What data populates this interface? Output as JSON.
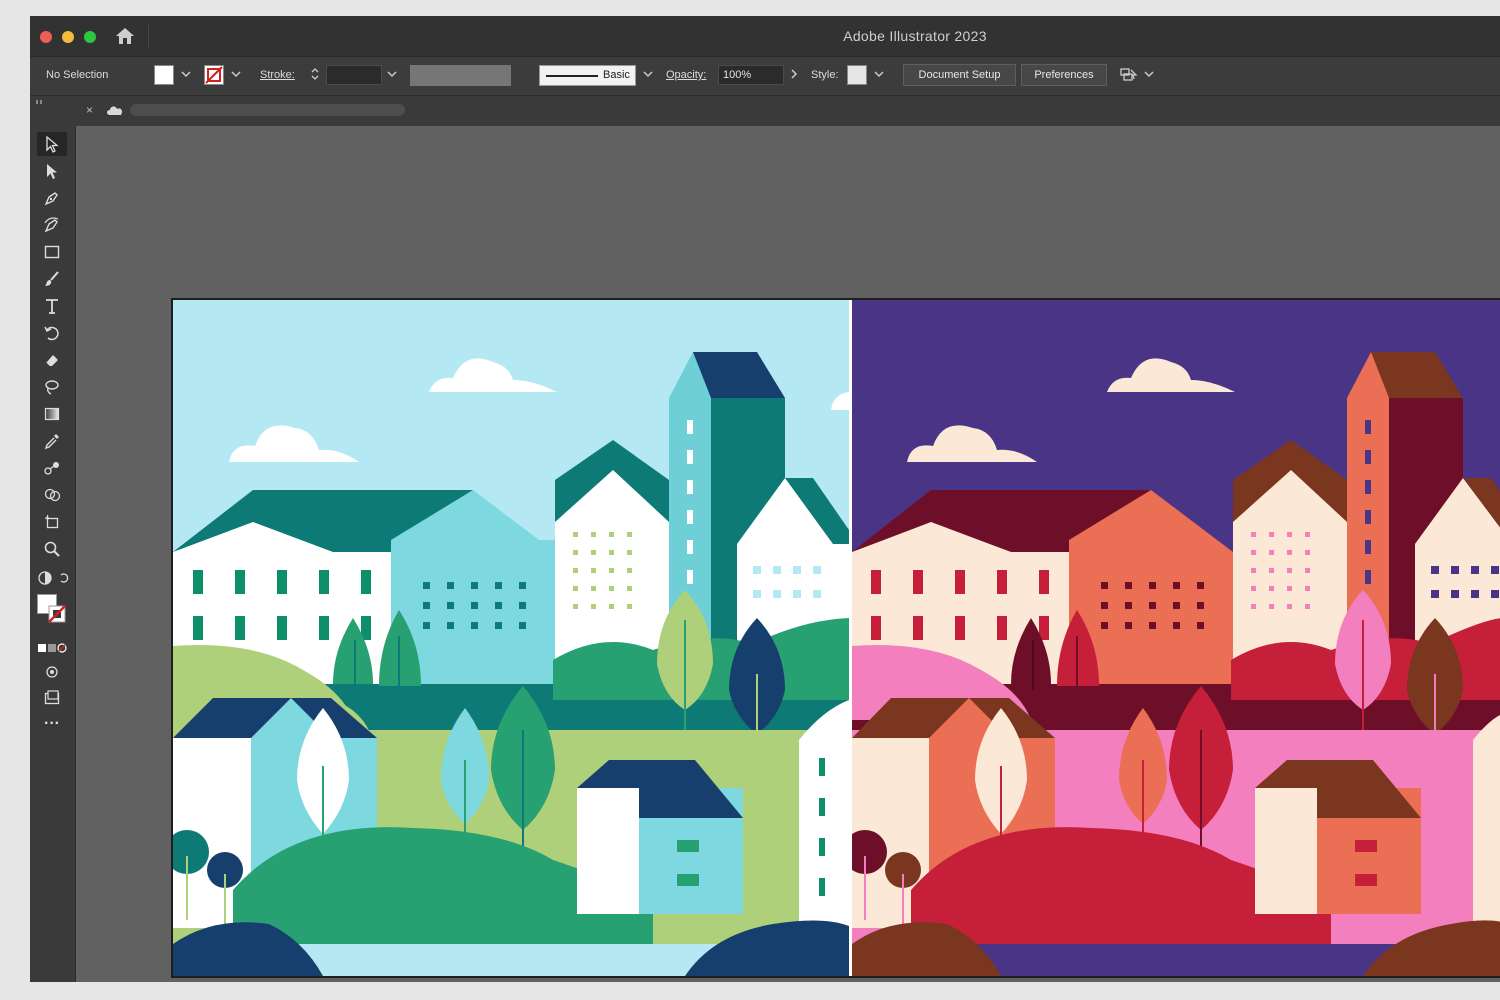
{
  "window": {
    "title": "Adobe Illustrator 2023",
    "buttons": [
      "close-button",
      "minimize-button",
      "zoom-button"
    ],
    "home_icon": "home-icon"
  },
  "control_bar": {
    "selection_status": "No Selection",
    "fill_color": "#ffffff",
    "stroke_label": "Stroke:",
    "stroke_value": "",
    "brush_label": "Basic",
    "opacity_label": "Opacity:",
    "opacity_value": "100%",
    "style_label": "Style:",
    "document_setup_label": "Document Setup",
    "preferences_label": "Preferences",
    "arrange_icon": "arrange-documents-icon"
  },
  "document_tab": {
    "close_label": "×",
    "cloud_icon": "cloud-document-icon"
  },
  "tools": [
    "selection-tool-icon",
    "direct-selection-tool-icon",
    "pen-tool-icon",
    "curvature-tool-icon",
    "rectangle-tool-icon",
    "paintbrush-tool-icon",
    "type-tool-icon",
    "rotate-tool-icon",
    "eraser-tool-icon",
    "lasso-tool-icon",
    "gradient-tool-icon",
    "eyedropper-tool-icon",
    "blend-tool-icon",
    "shape-builder-tool-icon",
    "artboard-tool-icon",
    "zoom-tool-icon"
  ],
  "tools_more_label": "···",
  "colors": {
    "left_sky": "#b4e8f3",
    "right_sky": "#4a3485",
    "teal_dark": "#0e7a75",
    "navy": "#173f6e",
    "green_light": "#aed07a",
    "green_mid": "#27a172",
    "maroon": "#6d0f28",
    "crimson": "#c51f3a",
    "pink": "#f47fbf",
    "coral": "#ea6f54",
    "cream": "#fbe8d6",
    "brown": "#7b3620"
  }
}
